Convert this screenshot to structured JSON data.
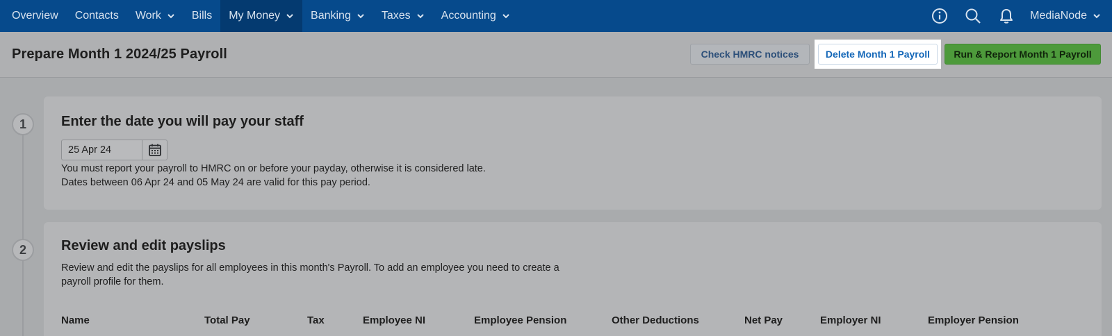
{
  "nav": {
    "items": [
      {
        "label": "Overview"
      },
      {
        "label": "Contacts"
      },
      {
        "label": "Work"
      },
      {
        "label": "Bills"
      },
      {
        "label": "My Money"
      },
      {
        "label": "Banking"
      },
      {
        "label": "Taxes"
      },
      {
        "label": "Accounting"
      }
    ],
    "user_label": "MediaNode"
  },
  "header": {
    "title": "Prepare Month 1 2024/25 Payroll",
    "check_label": "Check HMRC notices",
    "delete_label": "Delete Month 1 Payroll",
    "run_label": "Run & Report Month 1 Payroll"
  },
  "step1": {
    "number": "1",
    "title": "Enter the date you will pay your staff",
    "date_value": "25 Apr 24",
    "line1": "You must report your payroll to HMRC on or before your payday, otherwise it is considered late.",
    "line2": "Dates between 06 Apr 24 and 05 May 24 are valid for this pay period."
  },
  "step2": {
    "number": "2",
    "title": "Review and edit payslips",
    "line1": "Review and edit the payslips for all employees in this month's Payroll. To add an employee you need to create a",
    "line2": "payroll profile for them.",
    "columns": [
      "Name",
      "Total Pay",
      "Tax",
      "Employee NI",
      "Employee Pension",
      "Other Deductions",
      "Net Pay",
      "Employer NI",
      "Employer Pension"
    ]
  },
  "colors": {
    "nav_bg": "#064a8c",
    "run_button": "#4d9a3b",
    "link_blue": "#1467b8"
  }
}
